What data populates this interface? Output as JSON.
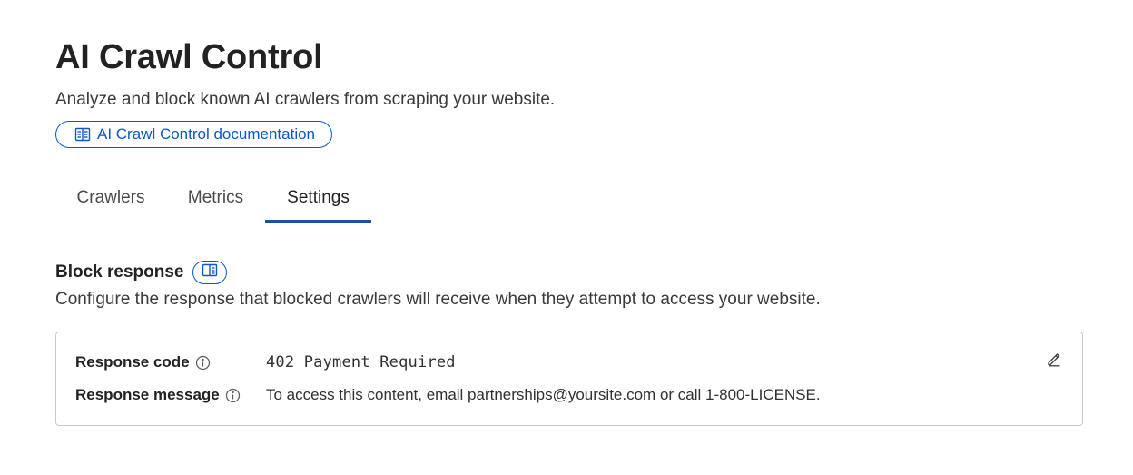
{
  "header": {
    "title": "AI Crawl Control",
    "subtitle": "Analyze and block known AI crawlers from scraping your website.",
    "doc_link_label": "AI Crawl Control documentation",
    "doc_link_icon": "book-open-icon"
  },
  "tabs": [
    {
      "label": "Crawlers",
      "active": false
    },
    {
      "label": "Metrics",
      "active": false
    },
    {
      "label": "Settings",
      "active": true
    }
  ],
  "block_response": {
    "title": "Block response",
    "title_icon": "book-open-icon",
    "description": "Configure the response that blocked crawlers will receive when they attempt to access your website.",
    "rows": [
      {
        "label": "Response code",
        "value": "402 Payment Required",
        "icon": "info-icon"
      },
      {
        "label": "Response message",
        "value": "To access this content, email partnerships@yoursite.com or call 1-800-LICENSE.",
        "icon": "info-icon"
      }
    ],
    "edit_icon": "pencil-icon"
  },
  "colors": {
    "accent": "#0b57d0",
    "tab_indicator": "#1f4fa8",
    "border": "#c9c9c9",
    "text": "#313131"
  }
}
